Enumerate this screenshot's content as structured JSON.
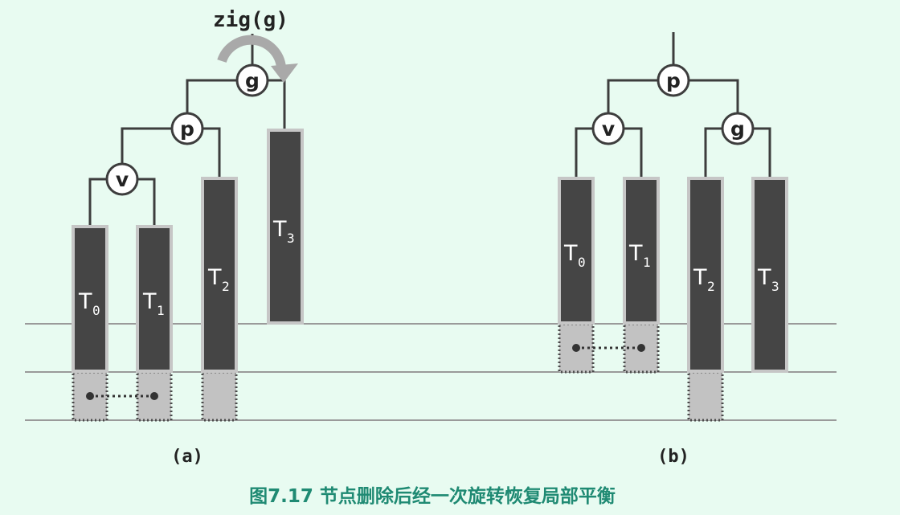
{
  "operation": "zig(g)",
  "nodes": {
    "g": "g",
    "p": "p",
    "v": "v"
  },
  "subtree_base": "T",
  "subtree_indices": [
    "0",
    "1",
    "2",
    "3"
  ],
  "panel_a_label": "(a)",
  "panel_b_label": "(b)",
  "caption": "图7.17 节点删除后经一次旋转恢复局部平衡",
  "colors": {
    "background": "#e8fbf1",
    "subtree_fill": "#454545",
    "subtree_border": "#c6c6c6",
    "ghost_fill": "#c2c2c2",
    "rotation_arrow": "#a9a9a9",
    "caption": "#1f8a73"
  }
}
